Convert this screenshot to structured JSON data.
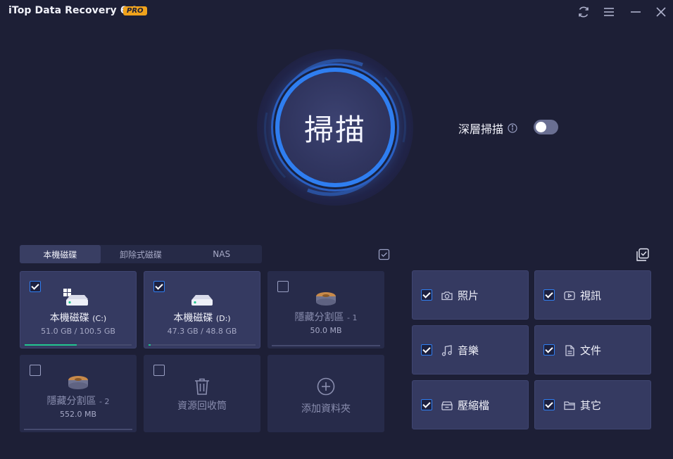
{
  "app": {
    "title": "iTop Data Recovery 6.0",
    "badge": "PRO"
  },
  "window_controls": [
    "refresh-icon",
    "menu-icon",
    "minimize-icon",
    "close-icon"
  ],
  "scan": {
    "label": "掃描"
  },
  "deep_scan": {
    "label": "深層掃描",
    "enabled": false
  },
  "tabs": [
    {
      "label": "本機磁碟",
      "active": true
    },
    {
      "label": "卸除式磁碟",
      "active": false
    },
    {
      "label": "NAS",
      "active": false
    }
  ],
  "drives": [
    {
      "name": "本機磁碟",
      "suffix": "(C:)",
      "size": "51.0 GB / 100.5 GB",
      "checked": true,
      "used_fraction": 0.51
    },
    {
      "name": "本機磁碟",
      "suffix": "(D:)",
      "size": "47.3 GB / 48.8 GB",
      "checked": true,
      "used_fraction": 0.02
    },
    {
      "name": "隱藏分割區",
      "suffix": "- 1",
      "size": "50.0 MB",
      "checked": false,
      "used_fraction": 0
    },
    {
      "name": "隱藏分割區",
      "suffix": "- 2",
      "size": "552.0 MB",
      "checked": false,
      "used_fraction": 0
    },
    {
      "name": "資源回收筒",
      "checked": false
    },
    {
      "name": "添加資料夾"
    }
  ],
  "file_types": [
    {
      "label": "照片",
      "icon": "camera-icon",
      "checked": true
    },
    {
      "label": "視訊",
      "icon": "video-icon",
      "checked": true
    },
    {
      "label": "音樂",
      "icon": "music-icon",
      "checked": true
    },
    {
      "label": "文件",
      "icon": "document-icon",
      "checked": true
    },
    {
      "label": "壓縮檔",
      "icon": "archive-icon",
      "checked": true
    },
    {
      "label": "其它",
      "icon": "folder-icon",
      "checked": true
    }
  ],
  "colors": {
    "background": "#1d1f36",
    "accent": "#2f7ef0",
    "pro_badge": "#f0a21c",
    "progress": "#22c58f"
  }
}
